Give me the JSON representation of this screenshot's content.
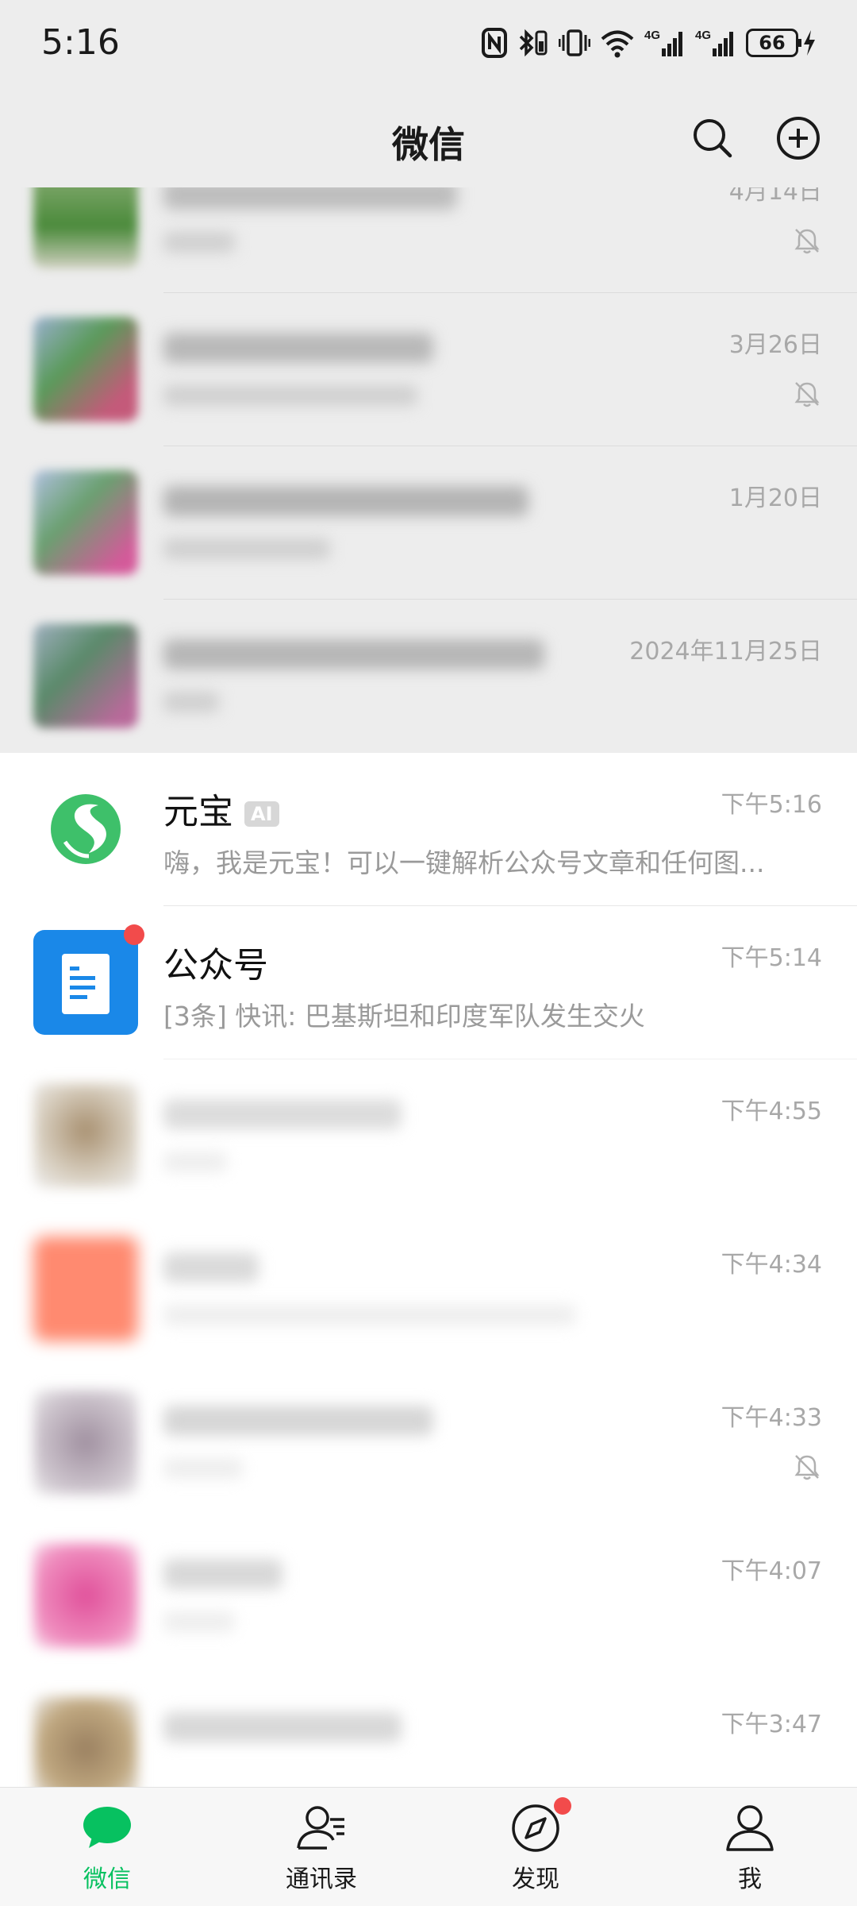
{
  "status_bar": {
    "time": "5:16",
    "battery": "66",
    "net1": "4G",
    "net2": "4G"
  },
  "header": {
    "title": "微信"
  },
  "chats": [
    {
      "time": "4月14日",
      "muted": true,
      "colors": [
        "#4a8a3a",
        "#6a9a5a"
      ]
    },
    {
      "time": "3月26日",
      "muted": true,
      "colors": [
        "#c45a7a",
        "#5a9a5a"
      ]
    },
    {
      "time": "1月20日",
      "muted": false,
      "colors": [
        "#d45a9a",
        "#6aa070"
      ]
    },
    {
      "time": "2024年11月25日",
      "muted": false,
      "colors": [
        "#b86a9a",
        "#5a8a6a"
      ]
    },
    {
      "name": "元宝",
      "tag": "AI",
      "message": "嗨，我是元宝！可以一键解析公众号文章和任何图...",
      "time": "下午5:16"
    },
    {
      "name": "公众号",
      "message": "[3条] 快讯: 巴基斯坦和印度军队发生交火",
      "time": "下午5:14"
    },
    {
      "time": "下午4:55",
      "muted": false,
      "colors": [
        "#b0a090",
        "#d0c0b0"
      ]
    },
    {
      "time": "下午4:34",
      "muted": false,
      "colors": [
        "#ff8a70",
        "#ffb0a0"
      ]
    },
    {
      "time": "下午4:33",
      "muted": true,
      "colors": [
        "#a090a0",
        "#c0b0c0"
      ]
    },
    {
      "time": "下午4:07",
      "muted": false,
      "colors": [
        "#e0509a",
        "#f090c0"
      ]
    },
    {
      "time": "下午3:47",
      "muted": false,
      "colors": [
        "#9a8060",
        "#c0a880"
      ]
    }
  ],
  "tabs": [
    {
      "label": "微信",
      "active": true
    },
    {
      "label": "通讯录",
      "active": false
    },
    {
      "label": "发现",
      "active": false
    },
    {
      "label": "我",
      "active": false
    }
  ],
  "accent": "#07c160"
}
